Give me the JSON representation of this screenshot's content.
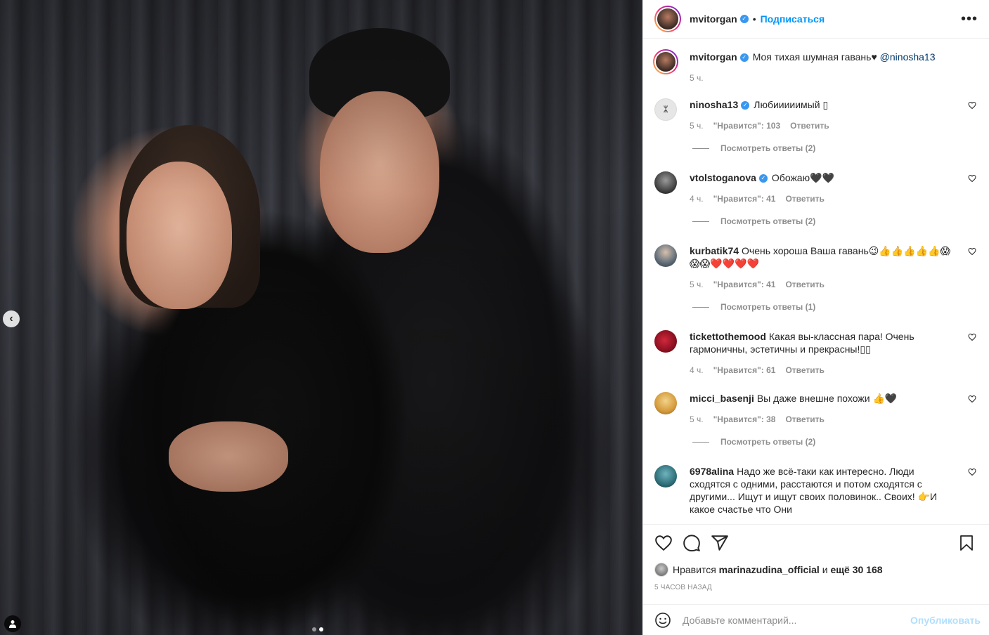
{
  "post_header": {
    "username": "mvitorgan",
    "separator": "•",
    "follow_label": "Подписаться",
    "more_label": "•••"
  },
  "caption": {
    "username": "mvitorgan",
    "text": "Моя тихая шумная гавань♥",
    "mention": "@ninosha13",
    "time": "5 ч."
  },
  "comments": [
    {
      "username": "ninosha13",
      "verified": true,
      "text": "Любииииимый ▯",
      "time": "5 ч.",
      "likes": "\"Нравится\": 103",
      "reply": "Ответить",
      "view_replies": "Посмотреть ответы (2)",
      "avatar_color": "#d9d9d9"
    },
    {
      "username": "vtolstoganova",
      "verified": true,
      "text": "Обожаю🖤🖤",
      "time": "4 ч.",
      "likes": "\"Нравится\": 41",
      "reply": "Ответить",
      "view_replies": "Посмотреть ответы (2)",
      "avatar_color": "#5a5a5a"
    },
    {
      "username": "kurbatik74",
      "verified": false,
      "text": "Очень хороша Ваша гавань😉👍👍👍👍👍😱😱😱❤️❤️❤️❤️",
      "time": "5 ч.",
      "likes": "\"Нравится\": 41",
      "reply": "Ответить",
      "view_replies": "Посмотреть ответы (1)",
      "avatar_color": "#7b8a99"
    },
    {
      "username": "tickettothemood",
      "verified": false,
      "text": "Какая вы-классная пара! Очень гармоничны, эстетичны и прекрасны!▯▯",
      "time": "4 ч.",
      "likes": "\"Нравится\": 61",
      "reply": "Ответить",
      "view_replies": "",
      "avatar_color": "#a01828"
    },
    {
      "username": "micci_basenji",
      "verified": false,
      "text": "Вы даже внешне похожи 👍🖤",
      "time": "5 ч.",
      "likes": "\"Нравится\": 38",
      "reply": "Ответить",
      "view_replies": "Посмотреть ответы (2)",
      "avatar_color": "#e3b23c"
    },
    {
      "username": "6978alina",
      "verified": false,
      "text": "Надо же всё-таки как интересно. Люди сходятся с одними, расстаются и потом сходятся с другими... Ищут и ищут своих половинок.. Своих! 👉И какое счастье что Они",
      "time": "",
      "likes": "",
      "reply": "",
      "view_replies": "",
      "avatar_color": "#2f6f7a"
    }
  ],
  "likes": {
    "prefix": "Нравится",
    "user": "marinazudina_official",
    "middle": "и",
    "count": "ещё 30 168"
  },
  "timestamp": "5 часов назад",
  "add_comment": {
    "placeholder": "Добавьте комментарий...",
    "post_label": "Опубликовать"
  },
  "colors": {
    "accent": "#0095f6",
    "verified": "#3897f0",
    "muted": "#8e8e8e",
    "post_disabled": "#b2dffc"
  }
}
